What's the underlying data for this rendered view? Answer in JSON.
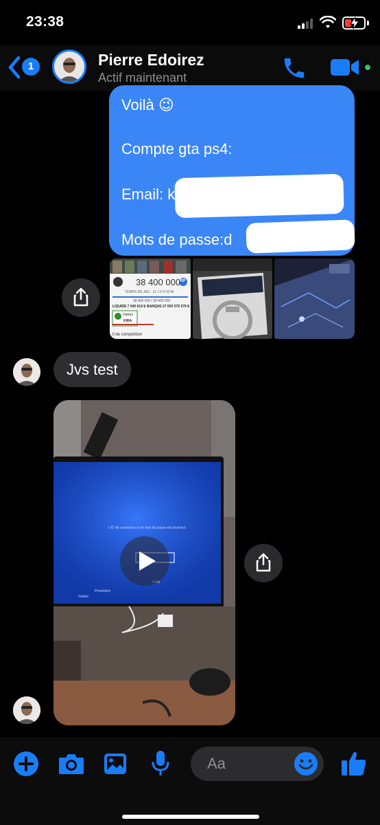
{
  "status_bar": {
    "time": "23:38",
    "battery_color": "#ff3b30"
  },
  "header": {
    "back_badge_count": "1",
    "contact_name": "Pierre Edoirez",
    "contact_status": "Actif maintenant",
    "accent_color": "#1a7df8",
    "online_color": "#31c85a",
    "icons": [
      "chevron-left-icon",
      "phone-icon",
      "video-camera-icon"
    ]
  },
  "messages": {
    "outgoing_text": {
      "line1": "Voilà 😉",
      "line2": "Compte gta ps4:",
      "line3_label": "Email: k",
      "line4_label": "Mots de passe:d",
      "bubble_color": "#3a86f6"
    },
    "photo_1": {
      "money": "38 400 000",
      "rp_badge": "RP",
      "playtime": "TEMPS DE JEU : 11 J 2 H 52 M",
      "money_small": "38 400 000 / 38 400 000",
      "liquid": "LIQUIDE 7 540 614 $",
      "bank": "BANQUE 27 002 579 279 $",
      "crew": "Daikyo",
      "crew_tag": "KIRA",
      "footer": "ll de compétition"
    },
    "incoming_text": "Jvs test",
    "video": {
      "screen_text": "L'ID de connexion ou le mot de passe est incorrect.",
      "validate": "Valider",
      "previous": "Précédent",
      "tv_brand": "AKAI"
    }
  },
  "composer": {
    "placeholder": "Aa",
    "icons": [
      "plus-icon",
      "camera-icon",
      "image-icon",
      "microphone-icon",
      "emoji-icon",
      "thumbs-up-icon"
    ]
  }
}
